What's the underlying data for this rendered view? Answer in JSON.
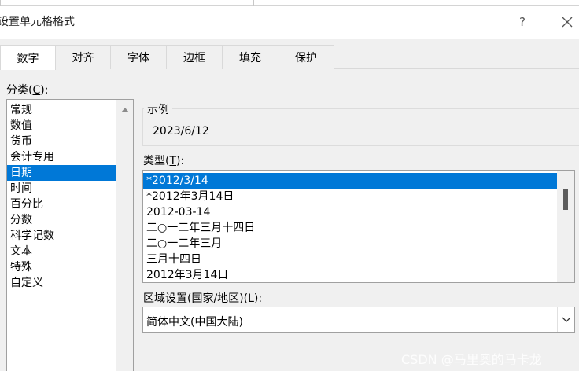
{
  "dialog": {
    "title": "设置单元格格式",
    "help_symbol": "?"
  },
  "tabs": [
    {
      "label": "数字",
      "active": true
    },
    {
      "label": "对齐",
      "active": false
    },
    {
      "label": "字体",
      "active": false
    },
    {
      "label": "边框",
      "active": false
    },
    {
      "label": "填充",
      "active": false
    },
    {
      "label": "保护",
      "active": false
    }
  ],
  "category": {
    "label_prefix": "分类(",
    "label_key": "C",
    "label_suffix": "):",
    "items": [
      "常规",
      "数值",
      "货币",
      "会计专用",
      "日期",
      "时间",
      "百分比",
      "分数",
      "科学记数",
      "文本",
      "特殊",
      "自定义"
    ],
    "selected_index": 4
  },
  "sample": {
    "legend": "示例",
    "value": "2023/6/12"
  },
  "type": {
    "label_prefix": "类型(",
    "label_key": "T",
    "label_suffix": "):",
    "items": [
      "*2012/3/14",
      "*2012年3月14日",
      "2012-03-14",
      "二○一二年三月十四日",
      "二○一二年三月",
      "三月十四日",
      "2012年3月14日"
    ],
    "selected_index": 0
  },
  "locale": {
    "label_prefix": "区域设置(国家/地区)(",
    "label_key": "L",
    "label_suffix": "):",
    "value": "简体中文(中国大陆)"
  },
  "watermark": "CSDN @马里奥的马卡龙",
  "colors": {
    "selection": "#0078d7",
    "dialog_bg": "#f0f0f0"
  }
}
